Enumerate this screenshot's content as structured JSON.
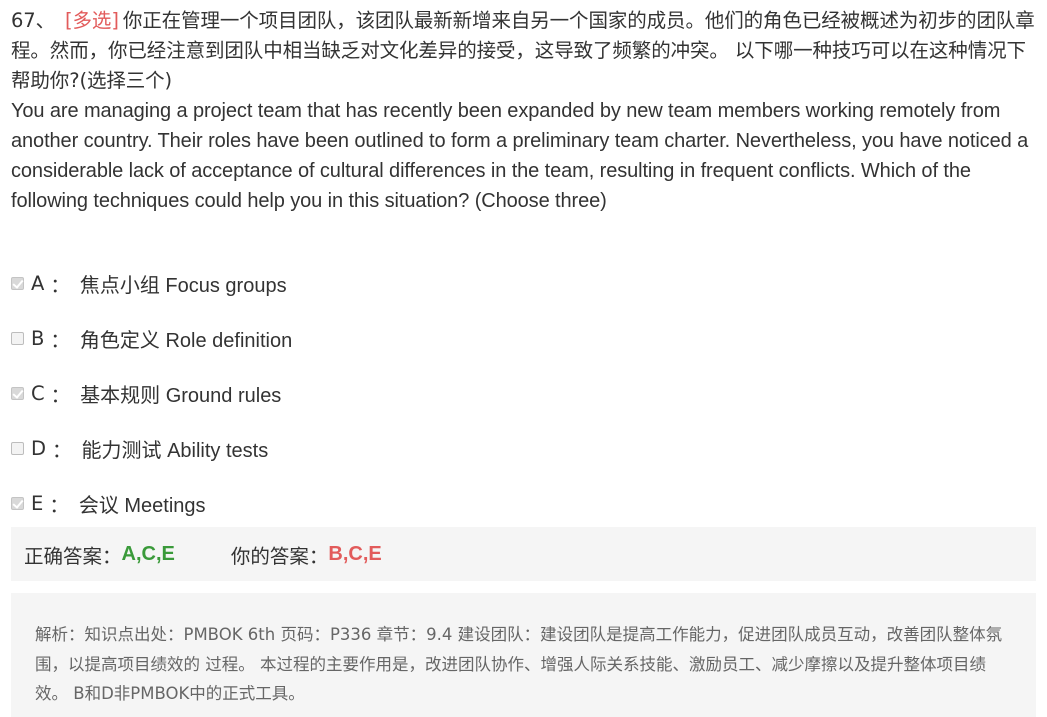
{
  "question": {
    "number": "67、",
    "type_tag": "[多选]",
    "text_cn": "你正在管理一个项目团队，该团队最新新增来自另一个国家的成员。他们的角色已经被概述为初步的团队章程。然而，你已经注意到团队中相当缺乏对文化差异的接受，这导致了频繁的冲突。 以下哪一种技巧可以在这种情况下帮助你?(选择三个)",
    "text_en": "You are managing a project team that has recently been expanded by new team members working remotely from another country. Their roles have been outlined to form a preliminary team charter. Nevertheless, you have noticed a considerable lack of acceptance of cultural differences in the team, resulting in frequent conflicts. Which of the following techniques could help you in this situation? (Choose three)"
  },
  "options": [
    {
      "letter": "A",
      "sep": "：",
      "text": "焦点小组 Focus groups",
      "checked": true
    },
    {
      "letter": "B",
      "sep": "：",
      "text": "角色定义 Role definition",
      "checked": false
    },
    {
      "letter": "C",
      "sep": "：",
      "text": "基本规则 Ground rules",
      "checked": true
    },
    {
      "letter": "D",
      "sep": "：",
      "text": "能力测试 Ability tests",
      "checked": false
    },
    {
      "letter": "E",
      "sep": "：",
      "text": "会议 Meetings",
      "checked": true
    }
  ],
  "answer": {
    "correct_label": "正确答案：",
    "correct_value": "A,C,E",
    "your_label": "你的答案：",
    "your_value": "B,C,E"
  },
  "analysis": {
    "text": "解析：知识点出处：PMBOK 6th 页码：P336 章节：9.4 建设团队：建设团队是提高工作能力，促进团队成员互动，改善团队整体氛围，以提高项目绩效的 过程。 本过程的主要作用是，改进团队协作、增强人际关系技能、激励员工、减少摩擦以及提升整体项目绩效。 B和D非PMBOK中的正式工具。"
  },
  "colors": {
    "type_tag": "#e25b5b",
    "correct": "#3a9a3a",
    "wrong": "#e25b5b",
    "box_bg": "#f5f5f5"
  }
}
